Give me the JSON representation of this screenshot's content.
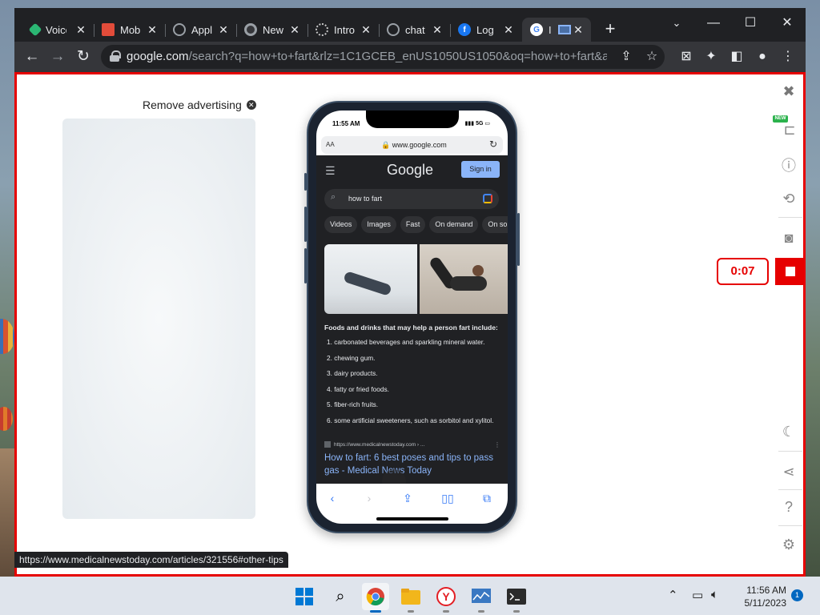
{
  "browser": {
    "tabs": [
      {
        "title": "Voice",
        "icon": "app-icon",
        "color": "#2bb673"
      },
      {
        "title": "Mob",
        "icon": "mobile-icon",
        "color": "#e24c3a"
      },
      {
        "title": "Appl",
        "icon": "globe-icon",
        "color": "#9aa0a6"
      },
      {
        "title": "New",
        "icon": "chrome-icon",
        "color": "#9aa0a6"
      },
      {
        "title": "Intro",
        "icon": "openai-icon",
        "color": "#9aa0a6"
      },
      {
        "title": "chat",
        "icon": "globe-icon",
        "color": "#9aa0a6"
      },
      {
        "title": "Log",
        "icon": "facebook-icon",
        "color": "#1877f2"
      },
      {
        "title": "I",
        "icon": "google-icon",
        "color": "#ffffff"
      }
    ],
    "address": {
      "host": "google.com",
      "path": "/search?q=how+to+fart&rlz=1C1GCEB_enUS1050US1050&oq=how+to+fart&aqs=..."
    },
    "status_url": "https://www.medicalnewstoday.com/articles/321556#other-tips"
  },
  "page": {
    "remove_ad_label": "Remove advertising",
    "timer": "0:07",
    "new_badge": "NEW"
  },
  "phone": {
    "time": "11:55 AM",
    "signal": "5G",
    "aa": "AA",
    "url": "www.google.com",
    "logo": "Google",
    "signin": "Sign in",
    "query": "how to fart",
    "chips": [
      "Videos",
      "Images",
      "Fast",
      "On demand",
      "On some"
    ],
    "snippet_heading": "Foods and drinks that may help a person fart include:",
    "snippet_items": [
      "1. carbonated beverages and sparkling mineral water.",
      "2. chewing gum.",
      "3. dairy products.",
      "4. fatty or fried foods.",
      "5. fiber-rich fruits.",
      "6. some artificial sweeteners, such as sorbitol and xylitol."
    ],
    "result_source": "https://www.medicalnewstoday.com › ...",
    "result_title": "How to fart: 6 best poses and tips to pass gas - Medical News Today"
  },
  "taskbar": {
    "clock_time": "11:56 AM",
    "clock_date": "5/11/2023",
    "notification_count": "1"
  }
}
